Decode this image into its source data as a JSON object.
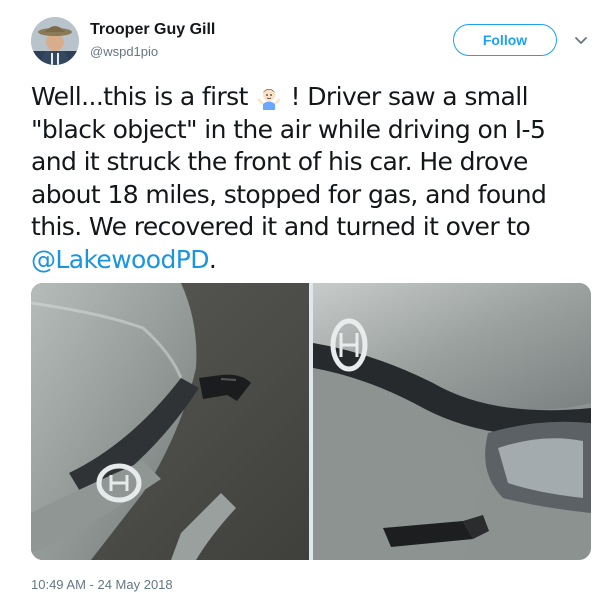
{
  "author": {
    "name": "Trooper Guy Gill",
    "handle": "@wspd1pio"
  },
  "actions": {
    "follow_label": "Follow"
  },
  "tweet": {
    "text_part1": "Well...this is a first",
    "text_part2": "! Driver saw a small \"black object\" in the air while driving on I-5 and it struck the front of his car.  He drove about 18 miles, stopped for gas, and found this.  We recovered it and turned it over to",
    "mention": "@LakewoodPD",
    "text_end": ".",
    "timestamp": "10:49 AM - 24 May 2018"
  },
  "icons": {
    "emoji": "person-shrugging-emoji",
    "chevron": "chevron-down-icon"
  },
  "colors": {
    "accent": "#1da1f2",
    "link": "#1b95e0",
    "muted": "#657786"
  }
}
